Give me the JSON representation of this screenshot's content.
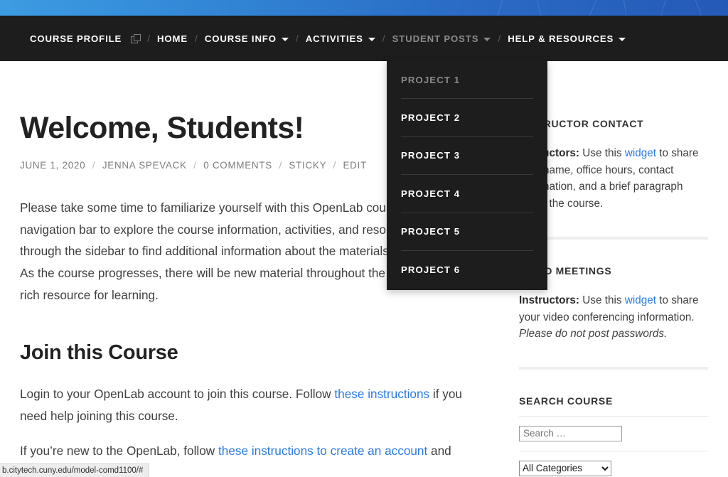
{
  "topbar": {
    "accent_left": "#3d9ce2",
    "accent_right": "#2559b8"
  },
  "nav": {
    "items": [
      {
        "label": "COURSE PROFILE",
        "icon": "external-link-icon",
        "has_caret": false,
        "state": "normal"
      },
      {
        "label": "HOME",
        "has_caret": false,
        "state": "normal"
      },
      {
        "label": "COURSE INFO",
        "has_caret": true,
        "state": "normal"
      },
      {
        "label": "ACTIVITIES",
        "has_caret": true,
        "state": "normal"
      },
      {
        "label": "STUDENT POSTS",
        "has_caret": true,
        "state": "dim"
      },
      {
        "label": "HELP & RESOURCES",
        "has_caret": true,
        "state": "normal"
      }
    ],
    "separator": "/"
  },
  "dropdown": {
    "parent": "STUDENT POSTS",
    "items": [
      {
        "label": "PROJECT 1",
        "state": "dim"
      },
      {
        "label": "PROJECT 2",
        "state": "normal"
      },
      {
        "label": "PROJECT 3",
        "state": "normal"
      },
      {
        "label": "PROJECT 4",
        "state": "normal"
      },
      {
        "label": "PROJECT 5",
        "state": "normal"
      },
      {
        "label": "PROJECT 6",
        "state": "normal"
      }
    ]
  },
  "post": {
    "title": "Welcome, Students!",
    "meta": {
      "date": "JUNE 1, 2020",
      "author": "JENNA SPEVACK",
      "comments": "0 COMMENTS",
      "sticky": "STICKY",
      "edit": "EDIT",
      "separator": "/"
    },
    "paragraph": "Please take some time to familiarize yourself with this OpenLab course. Use the top navigation bar to explore the course information, activities, and resources. Scroll through the sidebar to find additional information about the materials shared here. As the course progresses, there will be new material throughout the site, making it a rich resource for learning.",
    "section_heading": "Join this Course",
    "join_p1_a": "Login to your OpenLab account to join this course. Follow ",
    "join_p1_link": "these instructions",
    "join_p1_b": " if you need help joining this course.",
    "join_p2_a": "If you’re new to the OpenLab, follow ",
    "join_p2_link": "these instructions to create an account",
    "join_p2_b": " and"
  },
  "sidebar": {
    "contact": {
      "heading": "INSTRUCTOR CONTACT",
      "bold": "Instructors:",
      "text_a": " Use this ",
      "link": "widget",
      "text_b": " to share your name, office hours, contact information, and a brief paragraph about the course."
    },
    "meetings": {
      "heading": "VIDEO MEETINGS",
      "bold": "Instructors:",
      "text_a": " Use this ",
      "link": "widget",
      "text_b": " to share your video conferencing information. ",
      "italic": "Please do not post passwords."
    },
    "search": {
      "heading": "SEARCH COURSE",
      "placeholder": "Search …",
      "value": "",
      "category_selected": "All Categories"
    }
  },
  "status_bar": {
    "url": "b.citytech.cuny.edu/model-comd1100/#"
  }
}
